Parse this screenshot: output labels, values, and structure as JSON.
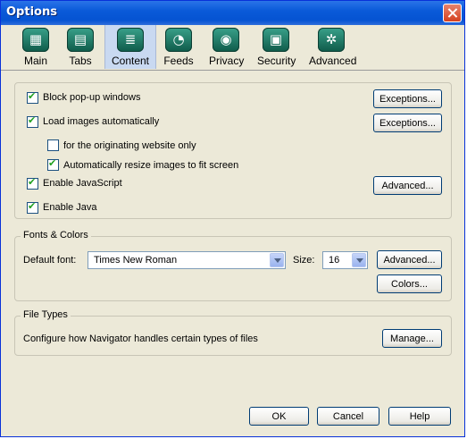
{
  "window": {
    "title": "Options"
  },
  "toolbar": {
    "items": [
      {
        "label": "Main",
        "icon": "grid-icon"
      },
      {
        "label": "Tabs",
        "icon": "tabs-icon"
      },
      {
        "label": "Content",
        "icon": "stack-icon",
        "selected": true
      },
      {
        "label": "Feeds",
        "icon": "rss-icon"
      },
      {
        "label": "Privacy",
        "icon": "eye-icon"
      },
      {
        "label": "Security",
        "icon": "lock-icon"
      },
      {
        "label": "Advanced",
        "icon": "gear-icon"
      }
    ]
  },
  "content": {
    "block_popups": {
      "label": "Block pop-up windows",
      "checked": true
    },
    "exceptions_1": "Exceptions...",
    "load_images": {
      "label": "Load images automatically",
      "checked": true
    },
    "exceptions_2": "Exceptions...",
    "originating_only": {
      "label": "for the originating website only",
      "checked": false
    },
    "resize_images": {
      "label": "Automatically resize images to fit screen",
      "checked": true
    },
    "enable_js": {
      "label": "Enable JavaScript",
      "checked": true
    },
    "advanced_js": "Advanced...",
    "enable_java": {
      "label": "Enable Java",
      "checked": true
    }
  },
  "fonts": {
    "group_label": "Fonts & Colors",
    "default_font_label": "Default font:",
    "default_font_value": "Times New Roman",
    "size_label": "Size:",
    "size_value": "16",
    "advanced": "Advanced...",
    "colors": "Colors..."
  },
  "filetypes": {
    "group_label": "File Types",
    "description": "Configure how Navigator handles certain types of files",
    "manage": "Manage..."
  },
  "footer": {
    "ok": "OK",
    "cancel": "Cancel",
    "help": "Help"
  },
  "colors": {
    "titlebar": "#0553D2",
    "window_bg": "#ECE9D8",
    "selected_tab": "#C9D9F1"
  }
}
